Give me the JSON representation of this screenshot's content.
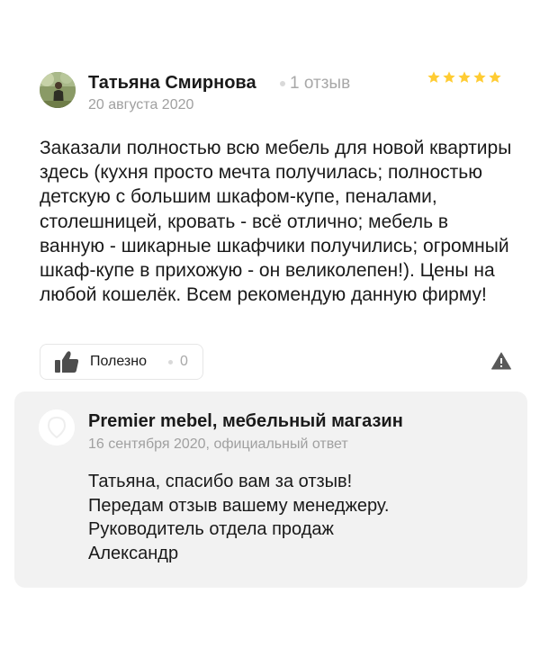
{
  "review": {
    "author": "Татьяна Смирнова",
    "review_count": "1 отзыв",
    "date": "20 августа 2020",
    "rating": 5,
    "text": "Заказали полностью всю мебель для новой квартиры здесь (кухня просто мечта получилась; полностью детскую с большим шкафом-купе, пеналами, столешницей, кровать - всё отлично; мебель в ванную - шикарные шкафчики получились; огромный шкаф-купе в прихожую - он великолепен!). Цены на любой кошелёк. Всем рекомендую данную фирму!",
    "helpful_label": "Полезно",
    "helpful_count": "0",
    "star_color": "#fc3"
  },
  "reply": {
    "company": "Premier mebel, мебельный магазин",
    "meta": "16 сентября 2020, официальный ответ",
    "lines": [
      "Татьяна, спасибо вам за отзыв!",
      "Передам отзыв вашему менеджеру.",
      "Руководитель отдела продаж",
      "Александр"
    ]
  }
}
